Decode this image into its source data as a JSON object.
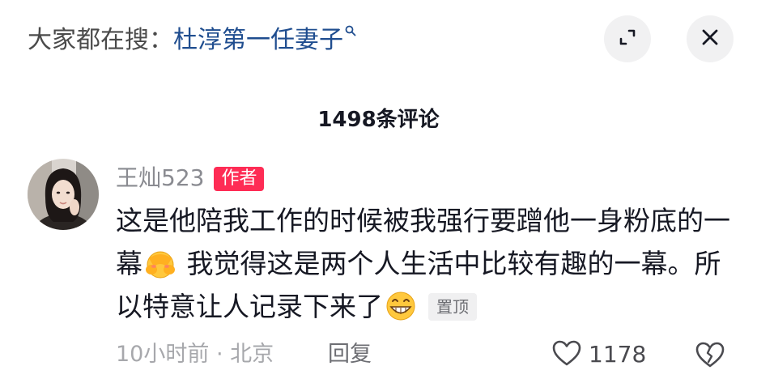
{
  "header": {
    "search_prefix": "大家都在搜：",
    "search_term": "杜淳第一任妻子",
    "search_icon": "search-icon",
    "expand_icon": "expand-icon",
    "close_icon": "close-icon"
  },
  "comments_header": {
    "count_label": "1498条评论"
  },
  "comment": {
    "author": "王灿523",
    "badge": "作者",
    "text_part1": "这是他陪我工作的时候被我强行要蹭他一身粉底的一幕",
    "text_part2": " 我觉得这是两个人生活中比较有趣的一幕。所以特意让人记录下来了",
    "emoji1": "shy-covering-face-emoji",
    "emoji2": "grinning-face-emoji",
    "pinned_label": "置顶",
    "time": "10小时前",
    "separator": "·",
    "location": "北京",
    "reply_label": "回复",
    "likes": "1178",
    "like_icon": "heart-outline-icon",
    "dislike_icon": "broken-heart-icon"
  },
  "colors": {
    "badge": "#fe2c55",
    "search_term": "#1f4d8f",
    "secondary_text": "#a7a8ac"
  }
}
